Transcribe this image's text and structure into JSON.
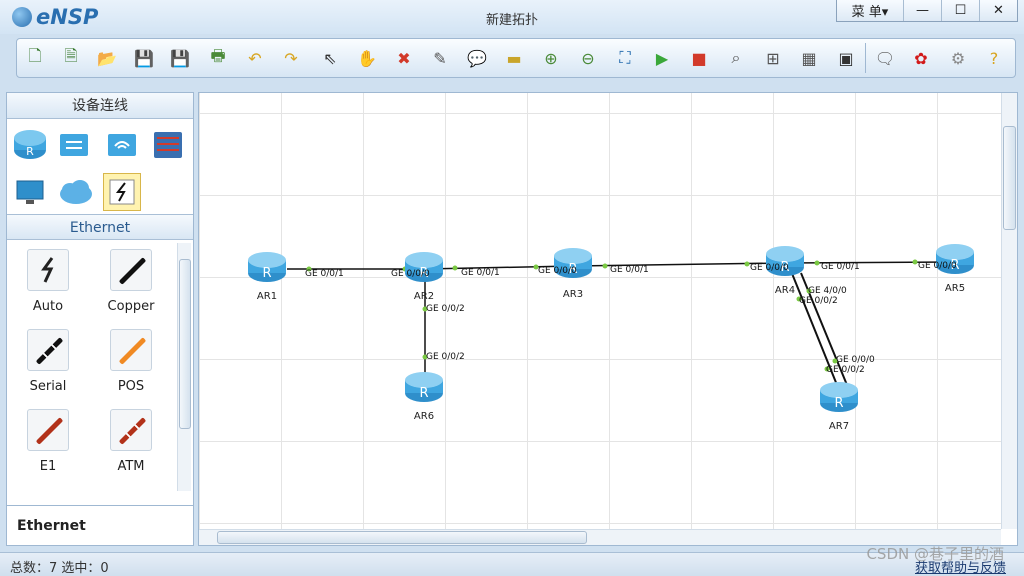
{
  "app": {
    "name": "eNSP",
    "window_title": "新建拓扑",
    "menu_label": "菜 单▾"
  },
  "window_controls": {
    "minimize": "—",
    "maximize": "☐",
    "close": "✕"
  },
  "toolbar_icons": [
    "new-topology",
    "new-example",
    "open",
    "save",
    "save-as",
    "print",
    "undo",
    "redo",
    "select",
    "pan-hand",
    "delete",
    "delete-links",
    "text-note",
    "rectangle",
    "zoom-in",
    "zoom-out",
    "fit-window",
    "start-all",
    "stop-all",
    "capture-data",
    "topology-view",
    "palette-grid",
    "console",
    "chat",
    "huawei-logo",
    "settings",
    "help"
  ],
  "left_panel": {
    "title": "设备连线",
    "devices": [
      "router-icon",
      "switch-icon",
      "wireless-icon",
      "firewall-icon",
      "pc-icon",
      "cloud-icon",
      "connection-icon"
    ],
    "category": "Ethernet",
    "cables": [
      {
        "label": "Auto",
        "color": "#222222",
        "icon": "auto-cable-icon"
      },
      {
        "label": "Copper",
        "color": "#111111",
        "icon": "copper-cable-icon"
      },
      {
        "label": "Serial",
        "color": "#111111",
        "icon": "serial-cable-icon"
      },
      {
        "label": "POS",
        "color": "#f08a24",
        "icon": "pos-cable-icon"
      },
      {
        "label": "E1",
        "color": "#b2321a",
        "icon": "e1-cable-icon"
      },
      {
        "label": "ATM",
        "color": "#b2321a",
        "icon": "atm-cable-icon"
      }
    ],
    "selected_label": "Ethernet"
  },
  "topology": {
    "routers": [
      {
        "id": "r1",
        "label": "AR1"
      },
      {
        "id": "r2",
        "label": "AR2"
      },
      {
        "id": "r3",
        "label": "AR3"
      },
      {
        "id": "r4",
        "label": "AR4"
      },
      {
        "id": "r5",
        "label": "AR5"
      },
      {
        "id": "r6",
        "label": "AR6"
      },
      {
        "id": "r7",
        "label": "AR7"
      }
    ],
    "port_labels": [
      "GE 0/0/1",
      "GE 0/0/0",
      "GE 0/0/1",
      "GE 0/0/0",
      "GE 0/0/1",
      "GE 0/0/0",
      "GE 0/0/1",
      "GE 0/0/0",
      "GE 0/0/2",
      "GE 0/0/2",
      "GE 4/0/0",
      "GE 0/0/2",
      "GE 0/0/0",
      "GE 0/0/2"
    ]
  },
  "status": {
    "text": "总数：7  选中：0",
    "help_link": "获取帮助与反馈"
  },
  "watermark": "CSDN @巷子里的酒",
  "colors": {
    "accent": "#2a6fb0",
    "router": "#3fa6e0",
    "link": "#111111",
    "port_dot": "#7ac943"
  }
}
